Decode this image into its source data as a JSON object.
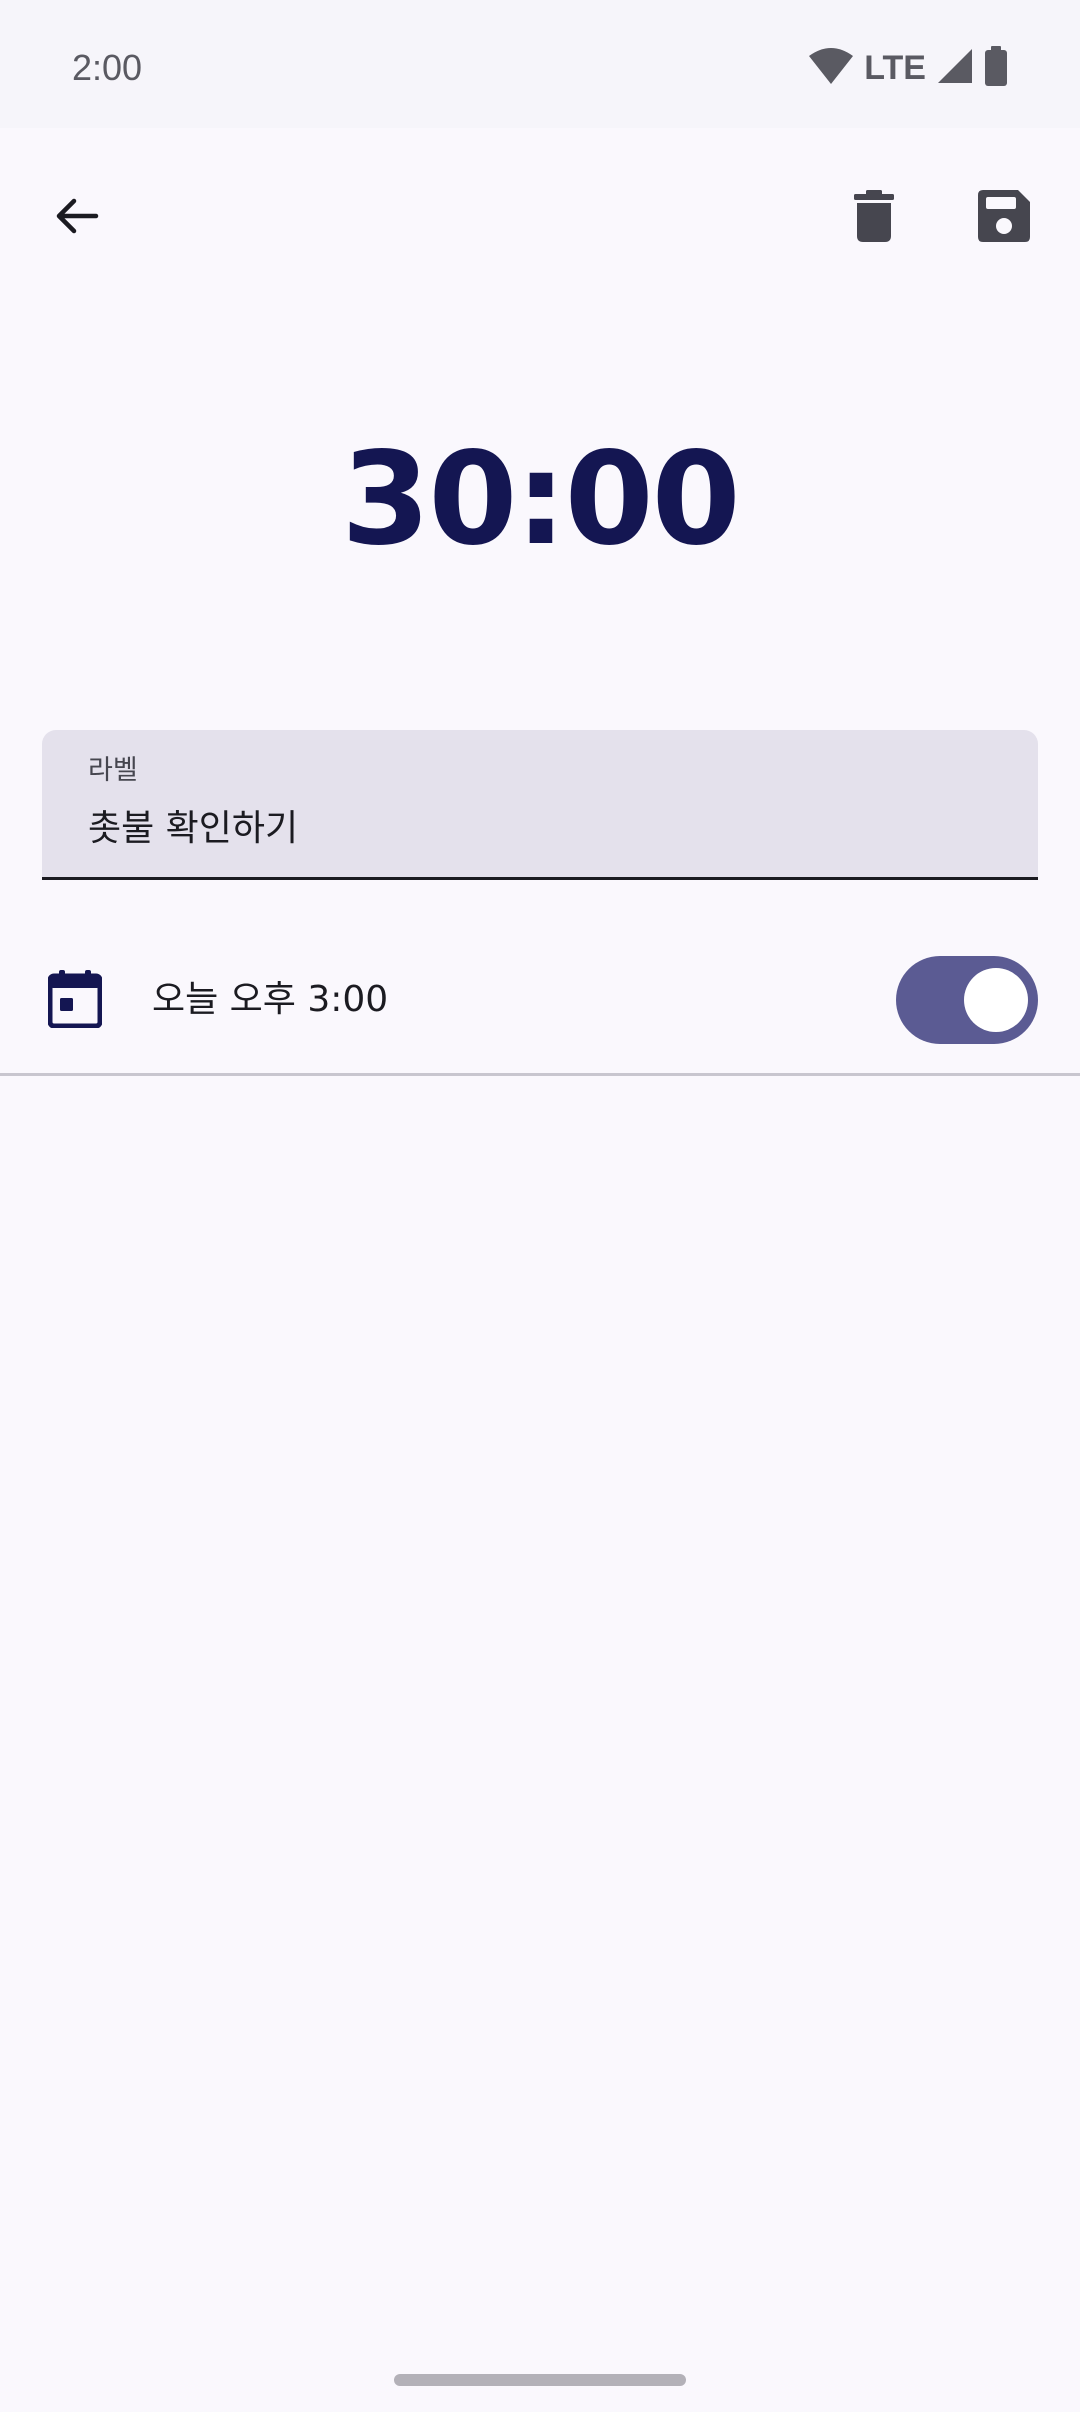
{
  "status_bar": {
    "time": "2:00",
    "network": "LTE",
    "icons": [
      "wifi-icon",
      "cell-signal-icon",
      "battery-icon"
    ]
  },
  "toolbar": {
    "back_icon": "arrow-left-icon",
    "delete_icon": "trash-icon",
    "save_icon": "floppy-disk-icon"
  },
  "timer": {
    "duration": "30:00"
  },
  "label_field": {
    "caption": "라벨",
    "value": "촛불 확인하기"
  },
  "schedule": {
    "icon": "calendar-icon",
    "text": "오늘 오후 3:00",
    "enabled": true
  },
  "colors": {
    "background": "#faf8fd",
    "primary_text": "#141652",
    "switch_track": "#5b5b93",
    "field_background": "#e4e1ec"
  }
}
